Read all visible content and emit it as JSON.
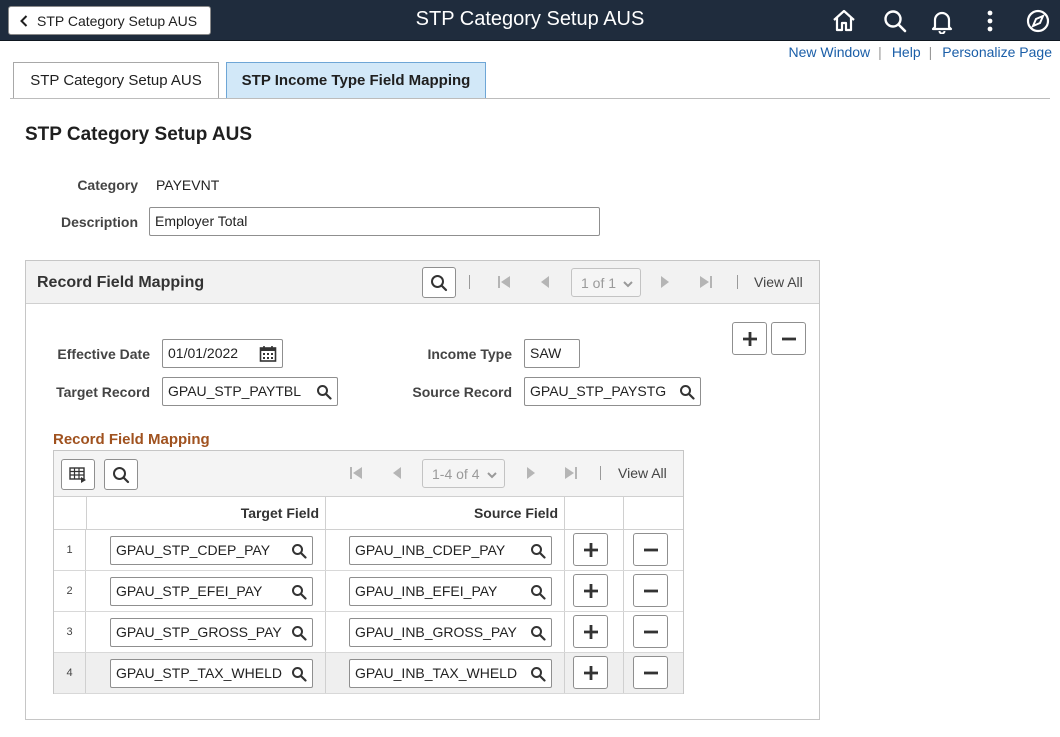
{
  "banner": {
    "back_label": "STP Category Setup AUS",
    "title": "STP Category Setup AUS",
    "icons": [
      "home-icon",
      "search-icon",
      "bell-icon",
      "kebab-menu-icon",
      "compass-icon"
    ]
  },
  "top_links": {
    "new_window": "New Window",
    "help": "Help",
    "personalize": "Personalize Page",
    "separator": "|"
  },
  "tabs": [
    {
      "label": "STP Category Setup AUS",
      "active": false
    },
    {
      "label": "STP Income Type Field Mapping",
      "active": true
    }
  ],
  "page": {
    "title": "STP Category Setup AUS",
    "category_label": "Category",
    "category_value": "PAYEVNT",
    "description_label": "Description",
    "description_value": "Employer Total"
  },
  "group": {
    "title": "Record Field Mapping",
    "pager": "1 of 1",
    "view_all": "View All",
    "effective_date_label": "Effective Date",
    "effective_date_value": "01/01/2022",
    "income_type_label": "Income Type",
    "income_type_value": "SAW",
    "target_record_label": "Target Record",
    "target_record_value": "GPAU_STP_PAYTBL",
    "source_record_label": "Source Record",
    "source_record_value": "GPAU_STP_PAYSTG"
  },
  "grid": {
    "title": "Record Field Mapping",
    "pager": "1-4 of 4",
    "view_all": "View All",
    "col_target": "Target Field",
    "col_source": "Source Field",
    "rows": [
      {
        "num": "1",
        "target": "GPAU_STP_CDEP_PAY",
        "source": "GPAU_INB_CDEP_PAY"
      },
      {
        "num": "2",
        "target": "GPAU_STP_EFEI_PAY",
        "source": "GPAU_INB_EFEI_PAY"
      },
      {
        "num": "3",
        "target": "GPAU_STP_GROSS_PAY",
        "source": "GPAU_INB_GROSS_PAY"
      },
      {
        "num": "4",
        "target": "GPAU_STP_TAX_WHELD",
        "source": "GPAU_INB_TAX_WHELD"
      }
    ]
  },
  "colors": {
    "banner": "#1f2c3d",
    "active_tab": "#d2e8f8",
    "link": "#1a5ea8",
    "subtitle": "#a0521f"
  }
}
